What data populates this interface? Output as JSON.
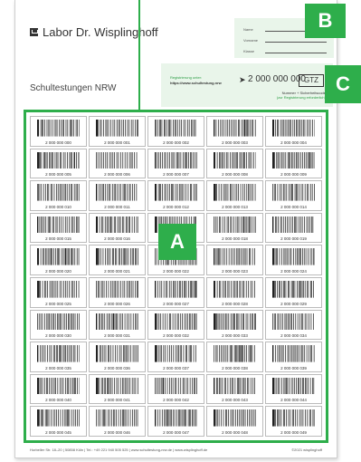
{
  "header": {
    "logo_text": "Labor Dr. Wisplinghoff",
    "subtitle": "Schultestungen NRW"
  },
  "name_form": {
    "fields": [
      "Name",
      "Vorname",
      "Klasse"
    ]
  },
  "registration": {
    "label": "Registrierung unter:",
    "url": "https://www.schultestung.nrw",
    "number": "2 000 000 000",
    "code": "GTZ",
    "caption": "Nummer + Sicherheitscode",
    "caption_sub": "(zur Registrierung erforderlich)"
  },
  "labels": [
    "2 000 000 000",
    "2 000 000 001",
    "2 000 000 002",
    "2 000 000 003",
    "2 000 000 004",
    "2 000 000 005",
    "2 000 000 006",
    "2 000 000 007",
    "2 000 000 008",
    "2 000 000 009",
    "2 000 000 010",
    "2 000 000 011",
    "2 000 000 012",
    "2 000 000 013",
    "2 000 000 014",
    "2 000 000 015",
    "2 000 000 016",
    "2 000 000 017",
    "2 000 000 018",
    "2 000 000 019",
    "2 000 000 020",
    "2 000 000 021",
    "2 000 000 022",
    "2 000 000 023",
    "2 000 000 024",
    "2 000 000 025",
    "2 000 000 026",
    "2 000 000 027",
    "2 000 000 028",
    "2 000 000 029",
    "2 000 000 030",
    "2 000 000 031",
    "2 000 000 032",
    "2 000 000 033",
    "2 000 000 034",
    "2 000 000 035",
    "2 000 000 036",
    "2 000 000 037",
    "2 000 000 038",
    "2 000 000 039",
    "2 000 000 040",
    "2 000 000 041",
    "2 000 000 042",
    "2 000 000 043",
    "2 000 000 044",
    "2 000 000 045",
    "2 000 000 046",
    "2 000 000 047",
    "2 000 000 048",
    "2 000 000 049"
  ],
  "footer": {
    "left": "Horbeller Str. 18–20 | 50858 Köln | Tel.: +49 221 940 505 525 | www.schultestung-nrw.de | www.wisplinghoff.de",
    "right": "©2021 wisplinghoff"
  },
  "callouts": {
    "a": "A",
    "b": "B",
    "c": "C"
  },
  "colors": {
    "accent": "#2eae4b",
    "panel": "#e9f5ea"
  }
}
